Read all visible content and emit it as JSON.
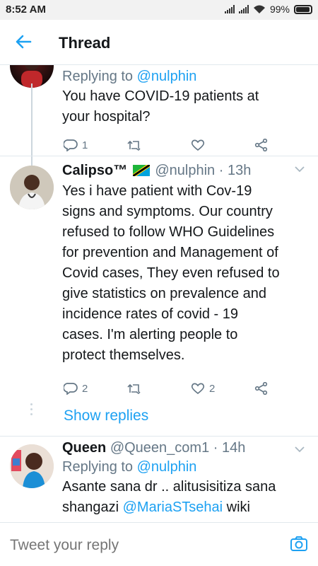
{
  "status": {
    "time": "8:52 AM",
    "battery": "99%"
  },
  "header": {
    "title": "Thread",
    "back_icon": "arrow-left-icon"
  },
  "tweets": [
    {
      "replying_prefix": "Replying to ",
      "replying_to": "@nulphin",
      "text_lines": [
        "You have COVID-19 patients at",
        "your hospital?"
      ],
      "reply_count": "1",
      "retweet_count": "",
      "like_count": ""
    },
    {
      "name": "Calipso™",
      "handle": "@nulphin · 13h",
      "text_lines": [
        "Yes i have patient with Cov-19",
        "signs and symptoms. Our country",
        "refused to follow WHO Guidelines",
        "for prevention and Management of",
        "Covid cases, They even refused to",
        "give statistics on prevalence and",
        "incidence rates of covid - 19",
        "cases. I'm alerting people to",
        "protect themselves."
      ],
      "reply_count": "2",
      "retweet_count": "",
      "like_count": "2",
      "show_replies": "Show replies"
    },
    {
      "name": "Queen",
      "handle": "@Queen_com1 · 14h",
      "replying_prefix": "Replying to ",
      "replying_to": "@nulphin",
      "text_line1": "Asante sana dr .. alitusisitiza sana",
      "text_line2_prefix": "shangazi ",
      "text_line2_mention": "@MariaSTsehai",
      "text_line2_suffix": " wiki"
    }
  ],
  "composer": {
    "placeholder": "Tweet your reply"
  },
  "colors": {
    "accent": "#1da1f2",
    "muted": "#657786",
    "text": "#14171a"
  }
}
